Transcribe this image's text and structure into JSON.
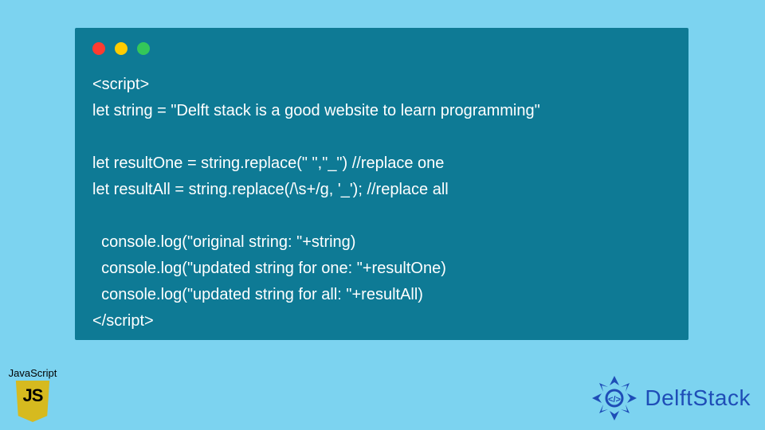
{
  "code": {
    "lines": [
      "<script>",
      "let string = \"Delft stack is a good website to learn programming\"",
      "",
      "let resultOne = string.replace(\" \",\"_\") //replace one",
      "let resultAll = string.replace(/\\s+/g, '_'); //replace all",
      "",
      "  console.log(\"original string: \"+string)",
      "  console.log(\"updated string for one: \"+resultOne)",
      "  console.log(\"updated string for all: \"+resultAll)",
      "</script>"
    ]
  },
  "js_badge": {
    "label": "JavaScript"
  },
  "delft": {
    "text": "DelftStack"
  }
}
